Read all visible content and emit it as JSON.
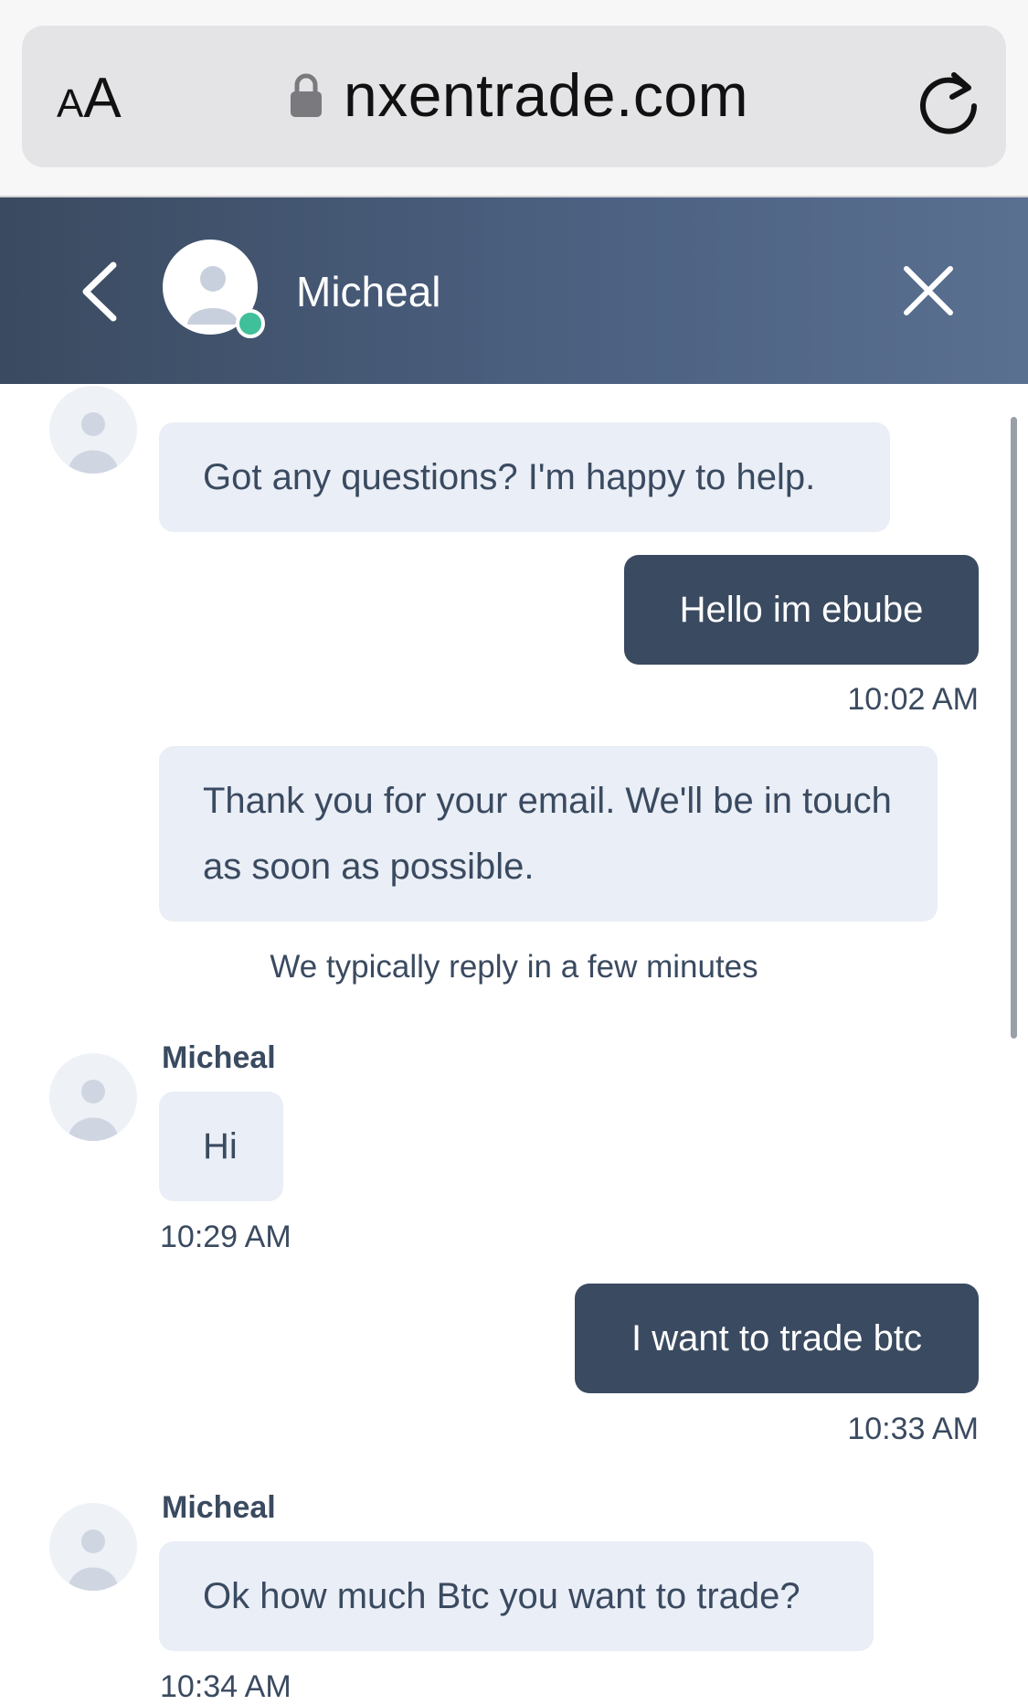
{
  "browser": {
    "aa_small": "A",
    "aa_big": "A",
    "url": "nxentrade.com",
    "lock_icon": "lock-icon",
    "reload_icon": "reload-icon"
  },
  "header": {
    "agent_name": "Micheal",
    "status_color": "#3fbf9a",
    "back_icon": "chevron-left-icon",
    "close_icon": "close-icon"
  },
  "messages": [
    {
      "direction": "in",
      "text": "Got any questions? I'm happy to help."
    },
    {
      "direction": "out",
      "text": "Hello im ebube",
      "time": "10:02 AM"
    },
    {
      "direction": "in",
      "text": "Thank you for your email. We'll be in touch as soon as possible."
    },
    {
      "direction": "notice",
      "text": "We typically reply in a few minutes"
    },
    {
      "direction": "in",
      "sender": "Micheal",
      "text": "Hi",
      "time": "10:29 AM"
    },
    {
      "direction": "out",
      "text": "I want to trade btc",
      "time": "10:33 AM"
    },
    {
      "direction": "in",
      "sender": "Micheal",
      "text": "Ok how much Btc you want to trade?",
      "time": "10:34 AM"
    }
  ],
  "colors": {
    "header_start": "#3a4a60",
    "header_end": "#5a7090",
    "incoming_bubble": "#eaeef6",
    "outgoing_bubble": "#3a4a60",
    "text": "#3a4a60"
  }
}
